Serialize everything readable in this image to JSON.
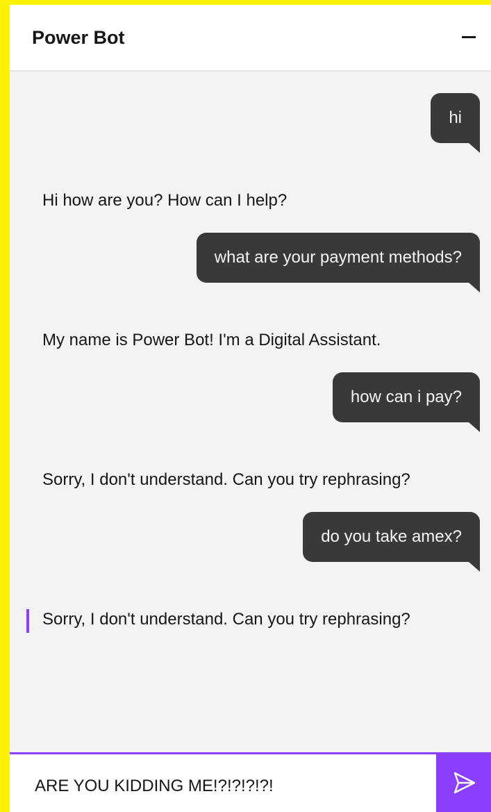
{
  "header": {
    "title": "Power Bot",
    "minimize_label": "minimize"
  },
  "messages": [
    {
      "role": "user",
      "text": "hi"
    },
    {
      "role": "bot",
      "text": "Hi how are you? How can I help?"
    },
    {
      "role": "user",
      "text": "what are your payment methods?"
    },
    {
      "role": "bot",
      "text": "My name is Power Bot! I'm a Digital Assistant."
    },
    {
      "role": "user",
      "text": "how can i pay?"
    },
    {
      "role": "bot",
      "text": "Sorry, I don't understand. Can you try rephrasing?"
    },
    {
      "role": "user",
      "text": "do you take amex?"
    },
    {
      "role": "bot",
      "text": "Sorry, I don't understand. Can you try rephrasing?"
    }
  ],
  "composer": {
    "value": "ARE YOU KIDDING ME!?!?!?!?!",
    "send_icon": "send-icon"
  },
  "colors": {
    "background": "#FFF200",
    "accent": "#8a3ffc",
    "user_bubble": "#393939",
    "chat_area": "#f3f3f3"
  }
}
